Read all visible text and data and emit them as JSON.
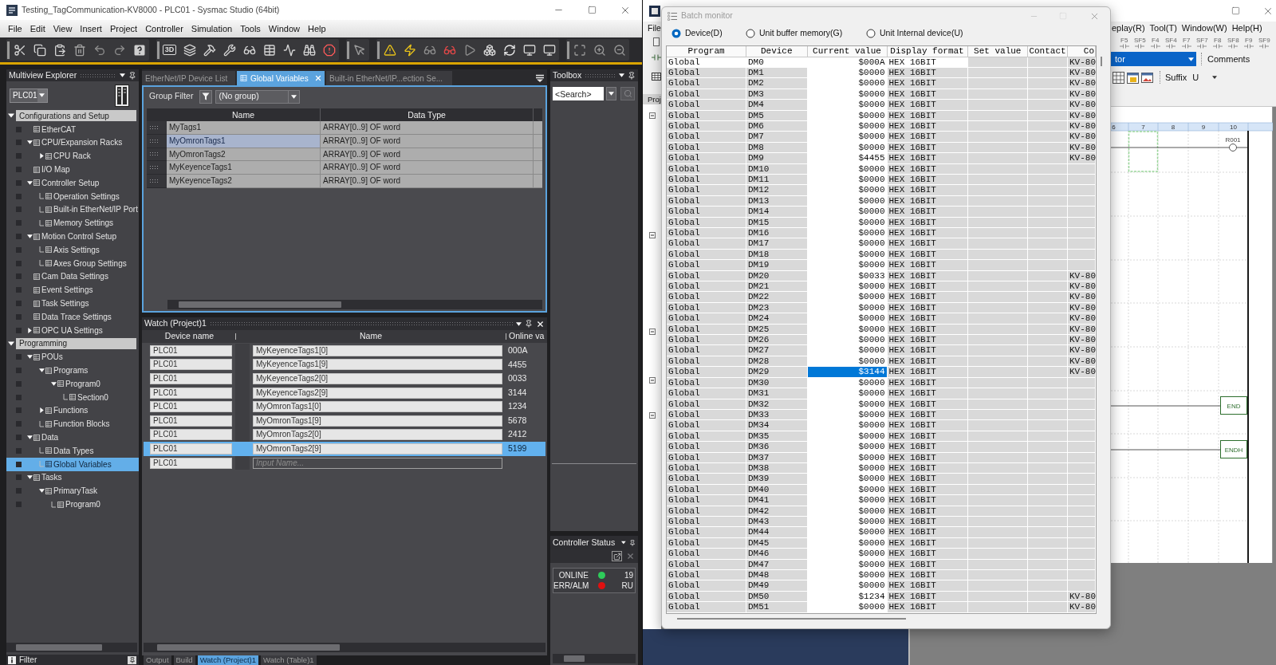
{
  "sysmac_window": {
    "title": "Testing_TagCommunication-KV8000 - PLC01 - Sysmac Studio (64bit)",
    "menu": [
      "File",
      "Edit",
      "View",
      "Insert",
      "Project",
      "Controller",
      "Simulation",
      "Tools",
      "Window",
      "Help"
    ],
    "toolbar": {
      "view_3d_label": "3D"
    }
  },
  "multiview_explorer": {
    "title": "Multiview Explorer",
    "controller": "PLC01",
    "filter_label": "Filter",
    "tree": [
      {
        "label": "Configurations and Setup",
        "kind": "section",
        "expanded": true,
        "selected": false,
        "children": [
          {
            "label": "EtherCAT",
            "selected": false
          },
          {
            "label": "CPU/Expansion Racks",
            "expanded": true,
            "selected": false,
            "children": [
              {
                "label": "CPU Rack",
                "expanded": false,
                "selected": false
              }
            ]
          },
          {
            "label": "I/O Map",
            "selected": false
          },
          {
            "label": "Controller Setup",
            "expanded": true,
            "selected": false,
            "children": [
              {
                "label": "Operation Settings",
                "selected": false
              },
              {
                "label": "Built-in EtherNet/IP Port",
                "selected": false
              },
              {
                "label": "Memory Settings",
                "selected": false
              }
            ]
          },
          {
            "label": "Motion Control Setup",
            "expanded": true,
            "selected": false,
            "children": [
              {
                "label": "Axis Settings",
                "selected": false
              },
              {
                "label": "Axes Group Settings",
                "selected": false
              }
            ]
          },
          {
            "label": "Cam Data Settings",
            "selected": false
          },
          {
            "label": "Event Settings",
            "selected": false
          },
          {
            "label": "Task Settings",
            "selected": false
          },
          {
            "label": "Data Trace Settings",
            "selected": false
          },
          {
            "label": "OPC UA Settings",
            "expanded": false,
            "selected": false
          }
        ]
      },
      {
        "label": "Programming",
        "kind": "section",
        "expanded": true,
        "selected": false,
        "children": [
          {
            "label": "POUs",
            "expanded": true,
            "selected": false,
            "children": [
              {
                "label": "Programs",
                "expanded": true,
                "selected": false,
                "children": [
                  {
                    "label": "Program0",
                    "expanded": true,
                    "selected": false,
                    "children": [
                      {
                        "label": "Section0",
                        "selected": false
                      }
                    ]
                  }
                ]
              },
              {
                "label": "Functions",
                "expanded": false,
                "selected": false
              },
              {
                "label": "Function Blocks",
                "selected": false
              }
            ]
          },
          {
            "label": "Data",
            "expanded": true,
            "selected": false,
            "children": [
              {
                "label": "Data Types",
                "selected": false
              },
              {
                "label": "Global Variables",
                "selected": true
              }
            ]
          },
          {
            "label": "Tasks",
            "expanded": true,
            "selected": false,
            "children": [
              {
                "label": "PrimaryTask",
                "expanded": true,
                "selected": false,
                "children": [
                  {
                    "label": "Program0",
                    "selected": false
                  }
                ]
              }
            ]
          }
        ]
      }
    ]
  },
  "editor_tabs": [
    {
      "label": "EtherNet/IP Device List",
      "selected": false
    },
    {
      "label": "Global Variables",
      "selected": true
    },
    {
      "label": "Built-in EtherNet/IP...ection Se...",
      "selected": false
    }
  ],
  "global_variables": {
    "group_filter_label": "Group Filter",
    "group_filter": "(No group)",
    "columns": [
      "Name",
      "Data Type"
    ],
    "rows": [
      {
        "name": "MyTags1",
        "data_type": "ARRAY[0..9] OF word",
        "selected": false
      },
      {
        "name": "MyOmronTags1",
        "data_type": "ARRAY[0..9] OF word",
        "selected": true
      },
      {
        "name": "MyOmronTags2",
        "data_type": "ARRAY[0..9] OF word",
        "selected": false
      },
      {
        "name": "MyKeyenceTags1",
        "data_type": "ARRAY[0..9] OF word",
        "selected": false
      },
      {
        "name": "MyKeyenceTags2",
        "data_type": "ARRAY[0..9] OF word",
        "selected": false
      }
    ]
  },
  "watch": {
    "title": "Watch (Project)1",
    "columns": [
      "Device name",
      "Name",
      "Online va"
    ],
    "rows": [
      {
        "device": "PLC01",
        "name": "MyKeyenceTags1[0]",
        "online_value": "000A",
        "selected": false
      },
      {
        "device": "PLC01",
        "name": "MyKeyenceTags1[9]",
        "online_value": "4455",
        "selected": false
      },
      {
        "device": "PLC01",
        "name": "MyKeyenceTags2[0]",
        "online_value": "0033",
        "selected": false
      },
      {
        "device": "PLC01",
        "name": "MyKeyenceTags2[9]",
        "online_value": "3144",
        "selected": false
      },
      {
        "device": "PLC01",
        "name": "MyOmronTags1[0]",
        "online_value": "1234",
        "selected": false
      },
      {
        "device": "PLC01",
        "name": "MyOmronTags1[9]",
        "online_value": "5678",
        "selected": false
      },
      {
        "device": "PLC01",
        "name": "MyOmronTags2[0]",
        "online_value": "2412",
        "selected": false
      },
      {
        "device": "PLC01",
        "name": "MyOmronTags2[9]",
        "online_value": "5199",
        "selected": true
      },
      {
        "device": "PLC01",
        "placeholder": "Input Name...",
        "selected": false
      }
    ]
  },
  "output_tabs": [
    {
      "label": "Output",
      "selected": false
    },
    {
      "label": "Build",
      "selected": false
    },
    {
      "label": "Watch (Project)1",
      "selected": true
    },
    {
      "label": "Watch (Table)1",
      "selected": false
    }
  ],
  "toolbox": {
    "title": "Toolbox",
    "search_placeholder": "<Search>"
  },
  "controller_status": {
    "title": "Controller Status",
    "indicators": [
      {
        "label": "ONLINE",
        "color": "#2ecc5a",
        "value": "19"
      },
      {
        "label": "ERR/ALM",
        "color": "#e01010",
        "value": "RU"
      }
    ]
  },
  "kv_studio": {
    "menu_left": [
      "File"
    ],
    "menu_right": [
      "eplay(R)",
      "Tool(T)",
      "Window(W)",
      "Help(H)"
    ],
    "function_keys": [
      "F5",
      "SF5",
      "F4",
      "SF4",
      "F7",
      "SF7",
      "F8",
      "SF8",
      "F9",
      "SF9"
    ],
    "mode_select": "tor",
    "comments_button": "Comments",
    "suffix_label": "Suffix",
    "suffix_value": "U",
    "project_tab": "Proj",
    "ladder": {
      "columns": [
        "6",
        "7",
        "8",
        "9",
        "10"
      ],
      "coil_label": "R001",
      "instructions": [
        "END",
        "ENDH"
      ]
    }
  },
  "batch_monitor": {
    "title": "Batch monitor",
    "options": [
      {
        "label": "Device(D)",
        "selected": true
      },
      {
        "label": "Unit buffer memory(G)",
        "selected": false
      },
      {
        "label": "Unit Internal device(U)",
        "selected": false
      }
    ],
    "columns": [
      "Program",
      "Device",
      "Current value",
      "Display format",
      "Set value",
      "Contact",
      "Co"
    ],
    "rows": [
      {
        "program": "Global",
        "device": "DM0",
        "current_value": "$000A",
        "display_format": "HEX 16BIT",
        "column_7": "KV-80",
        "highlighted": true,
        "selected": false
      },
      {
        "program": "Global",
        "device": "DM1",
        "current_value": "$0000",
        "display_format": "HEX 16BIT",
        "column_7": "KV-80",
        "highlighted": false,
        "selected": false
      },
      {
        "program": "Global",
        "device": "DM2",
        "current_value": "$0000",
        "display_format": "HEX 16BIT",
        "column_7": "KV-80",
        "highlighted": false,
        "selected": false
      },
      {
        "program": "Global",
        "device": "DM3",
        "current_value": "$0000",
        "display_format": "HEX 16BIT",
        "column_7": "KV-80",
        "highlighted": false,
        "selected": false
      },
      {
        "program": "Global",
        "device": "DM4",
        "current_value": "$0000",
        "display_format": "HEX 16BIT",
        "column_7": "KV-80",
        "highlighted": false,
        "selected": false
      },
      {
        "program": "Global",
        "device": "DM5",
        "current_value": "$0000",
        "display_format": "HEX 16BIT",
        "column_7": "KV-80",
        "highlighted": false,
        "selected": false
      },
      {
        "program": "Global",
        "device": "DM6",
        "current_value": "$0000",
        "display_format": "HEX 16BIT",
        "column_7": "KV-80",
        "highlighted": false,
        "selected": false
      },
      {
        "program": "Global",
        "device": "DM7",
        "current_value": "$0000",
        "display_format": "HEX 16BIT",
        "column_7": "KV-80",
        "highlighted": false,
        "selected": false
      },
      {
        "program": "Global",
        "device": "DM8",
        "current_value": "$0000",
        "display_format": "HEX 16BIT",
        "column_7": "KV-80",
        "highlighted": false,
        "selected": false
      },
      {
        "program": "Global",
        "device": "DM9",
        "current_value": "$4455",
        "display_format": "HEX 16BIT",
        "column_7": "KV-80",
        "highlighted": false,
        "selected": false
      },
      {
        "program": "Global",
        "device": "DM10",
        "current_value": "$0000",
        "display_format": "HEX 16BIT",
        "highlighted": false,
        "selected": false
      },
      {
        "program": "Global",
        "device": "DM11",
        "current_value": "$0000",
        "display_format": "HEX 16BIT",
        "highlighted": false,
        "selected": false
      },
      {
        "program": "Global",
        "device": "DM12",
        "current_value": "$0000",
        "display_format": "HEX 16BIT",
        "highlighted": false,
        "selected": false
      },
      {
        "program": "Global",
        "device": "DM13",
        "current_value": "$0000",
        "display_format": "HEX 16BIT",
        "highlighted": false,
        "selected": false
      },
      {
        "program": "Global",
        "device": "DM14",
        "current_value": "$0000",
        "display_format": "HEX 16BIT",
        "highlighted": false,
        "selected": false
      },
      {
        "program": "Global",
        "device": "DM15",
        "current_value": "$0000",
        "display_format": "HEX 16BIT",
        "highlighted": false,
        "selected": false
      },
      {
        "program": "Global",
        "device": "DM16",
        "current_value": "$0000",
        "display_format": "HEX 16BIT",
        "highlighted": false,
        "selected": false
      },
      {
        "program": "Global",
        "device": "DM17",
        "current_value": "$0000",
        "display_format": "HEX 16BIT",
        "highlighted": false,
        "selected": false
      },
      {
        "program": "Global",
        "device": "DM18",
        "current_value": "$0000",
        "display_format": "HEX 16BIT",
        "highlighted": false,
        "selected": false
      },
      {
        "program": "Global",
        "device": "DM19",
        "current_value": "$0000",
        "display_format": "HEX 16BIT",
        "highlighted": false,
        "selected": false
      },
      {
        "program": "Global",
        "device": "DM20",
        "current_value": "$0033",
        "display_format": "HEX 16BIT",
        "column_7": "KV-80",
        "highlighted": false,
        "selected": false
      },
      {
        "program": "Global",
        "device": "DM21",
        "current_value": "$0000",
        "display_format": "HEX 16BIT",
        "column_7": "KV-80",
        "highlighted": false,
        "selected": false
      },
      {
        "program": "Global",
        "device": "DM22",
        "current_value": "$0000",
        "display_format": "HEX 16BIT",
        "column_7": "KV-80",
        "highlighted": false,
        "selected": false
      },
      {
        "program": "Global",
        "device": "DM23",
        "current_value": "$0000",
        "display_format": "HEX 16BIT",
        "column_7": "KV-80",
        "highlighted": false,
        "selected": false
      },
      {
        "program": "Global",
        "device": "DM24",
        "current_value": "$0000",
        "display_format": "HEX 16BIT",
        "column_7": "KV-80",
        "highlighted": false,
        "selected": false
      },
      {
        "program": "Global",
        "device": "DM25",
        "current_value": "$0000",
        "display_format": "HEX 16BIT",
        "column_7": "KV-80",
        "highlighted": false,
        "selected": false
      },
      {
        "program": "Global",
        "device": "DM26",
        "current_value": "$0000",
        "display_format": "HEX 16BIT",
        "column_7": "KV-80",
        "highlighted": false,
        "selected": false
      },
      {
        "program": "Global",
        "device": "DM27",
        "current_value": "$0000",
        "display_format": "HEX 16BIT",
        "column_7": "KV-80",
        "highlighted": false,
        "selected": false
      },
      {
        "program": "Global",
        "device": "DM28",
        "current_value": "$0000",
        "display_format": "HEX 16BIT",
        "column_7": "KV-80",
        "highlighted": false,
        "selected": false
      },
      {
        "program": "Global",
        "device": "DM29",
        "current_value": "$3144",
        "display_format": "HEX 16BIT",
        "column_7": "KV-80",
        "highlighted": false,
        "selected": true
      },
      {
        "program": "Global",
        "device": "DM30",
        "current_value": "$0000",
        "display_format": "HEX 16BIT",
        "highlighted": false,
        "selected": false
      },
      {
        "program": "Global",
        "device": "DM31",
        "current_value": "$0000",
        "display_format": "HEX 16BIT",
        "highlighted": false,
        "selected": false
      },
      {
        "program": "Global",
        "device": "DM32",
        "current_value": "$0000",
        "display_format": "HEX 16BIT",
        "highlighted": false,
        "selected": false
      },
      {
        "program": "Global",
        "device": "DM33",
        "current_value": "$0000",
        "display_format": "HEX 16BIT",
        "highlighted": false,
        "selected": false
      },
      {
        "program": "Global",
        "device": "DM34",
        "current_value": "$0000",
        "display_format": "HEX 16BIT",
        "highlighted": false,
        "selected": false
      },
      {
        "program": "Global",
        "device": "DM35",
        "current_value": "$0000",
        "display_format": "HEX 16BIT",
        "highlighted": false,
        "selected": false
      },
      {
        "program": "Global",
        "device": "DM36",
        "current_value": "$0000",
        "display_format": "HEX 16BIT",
        "highlighted": false,
        "selected": false
      },
      {
        "program": "Global",
        "device": "DM37",
        "current_value": "$0000",
        "display_format": "HEX 16BIT",
        "highlighted": false,
        "selected": false
      },
      {
        "program": "Global",
        "device": "DM38",
        "current_value": "$0000",
        "display_format": "HEX 16BIT",
        "highlighted": false,
        "selected": false
      },
      {
        "program": "Global",
        "device": "DM39",
        "current_value": "$0000",
        "display_format": "HEX 16BIT",
        "highlighted": false,
        "selected": false
      },
      {
        "program": "Global",
        "device": "DM40",
        "current_value": "$0000",
        "display_format": "HEX 16BIT",
        "highlighted": false,
        "selected": false
      },
      {
        "program": "Global",
        "device": "DM41",
        "current_value": "$0000",
        "display_format": "HEX 16BIT",
        "highlighted": false,
        "selected": false
      },
      {
        "program": "Global",
        "device": "DM42",
        "current_value": "$0000",
        "display_format": "HEX 16BIT",
        "highlighted": false,
        "selected": false
      },
      {
        "program": "Global",
        "device": "DM43",
        "current_value": "$0000",
        "display_format": "HEX 16BIT",
        "highlighted": false,
        "selected": false
      },
      {
        "program": "Global",
        "device": "DM44",
        "current_value": "$0000",
        "display_format": "HEX 16BIT",
        "highlighted": false,
        "selected": false
      },
      {
        "program": "Global",
        "device": "DM45",
        "current_value": "$0000",
        "display_format": "HEX 16BIT",
        "highlighted": false,
        "selected": false
      },
      {
        "program": "Global",
        "device": "DM46",
        "current_value": "$0000",
        "display_format": "HEX 16BIT",
        "highlighted": false,
        "selected": false
      },
      {
        "program": "Global",
        "device": "DM47",
        "current_value": "$0000",
        "display_format": "HEX 16BIT",
        "highlighted": false,
        "selected": false
      },
      {
        "program": "Global",
        "device": "DM48",
        "current_value": "$0000",
        "display_format": "HEX 16BIT",
        "highlighted": false,
        "selected": false
      },
      {
        "program": "Global",
        "device": "DM49",
        "current_value": "$0000",
        "display_format": "HEX 16BIT",
        "highlighted": false,
        "selected": false
      },
      {
        "program": "Global",
        "device": "DM50",
        "current_value": "$1234",
        "display_format": "HEX 16BIT",
        "column_7": "KV-80",
        "highlighted": false,
        "selected": false
      },
      {
        "program": "Global",
        "device": "DM51",
        "current_value": "$0000",
        "display_format": "HEX 16BIT",
        "column_7": "KV-80",
        "highlighted": false,
        "selected": false
      }
    ]
  }
}
